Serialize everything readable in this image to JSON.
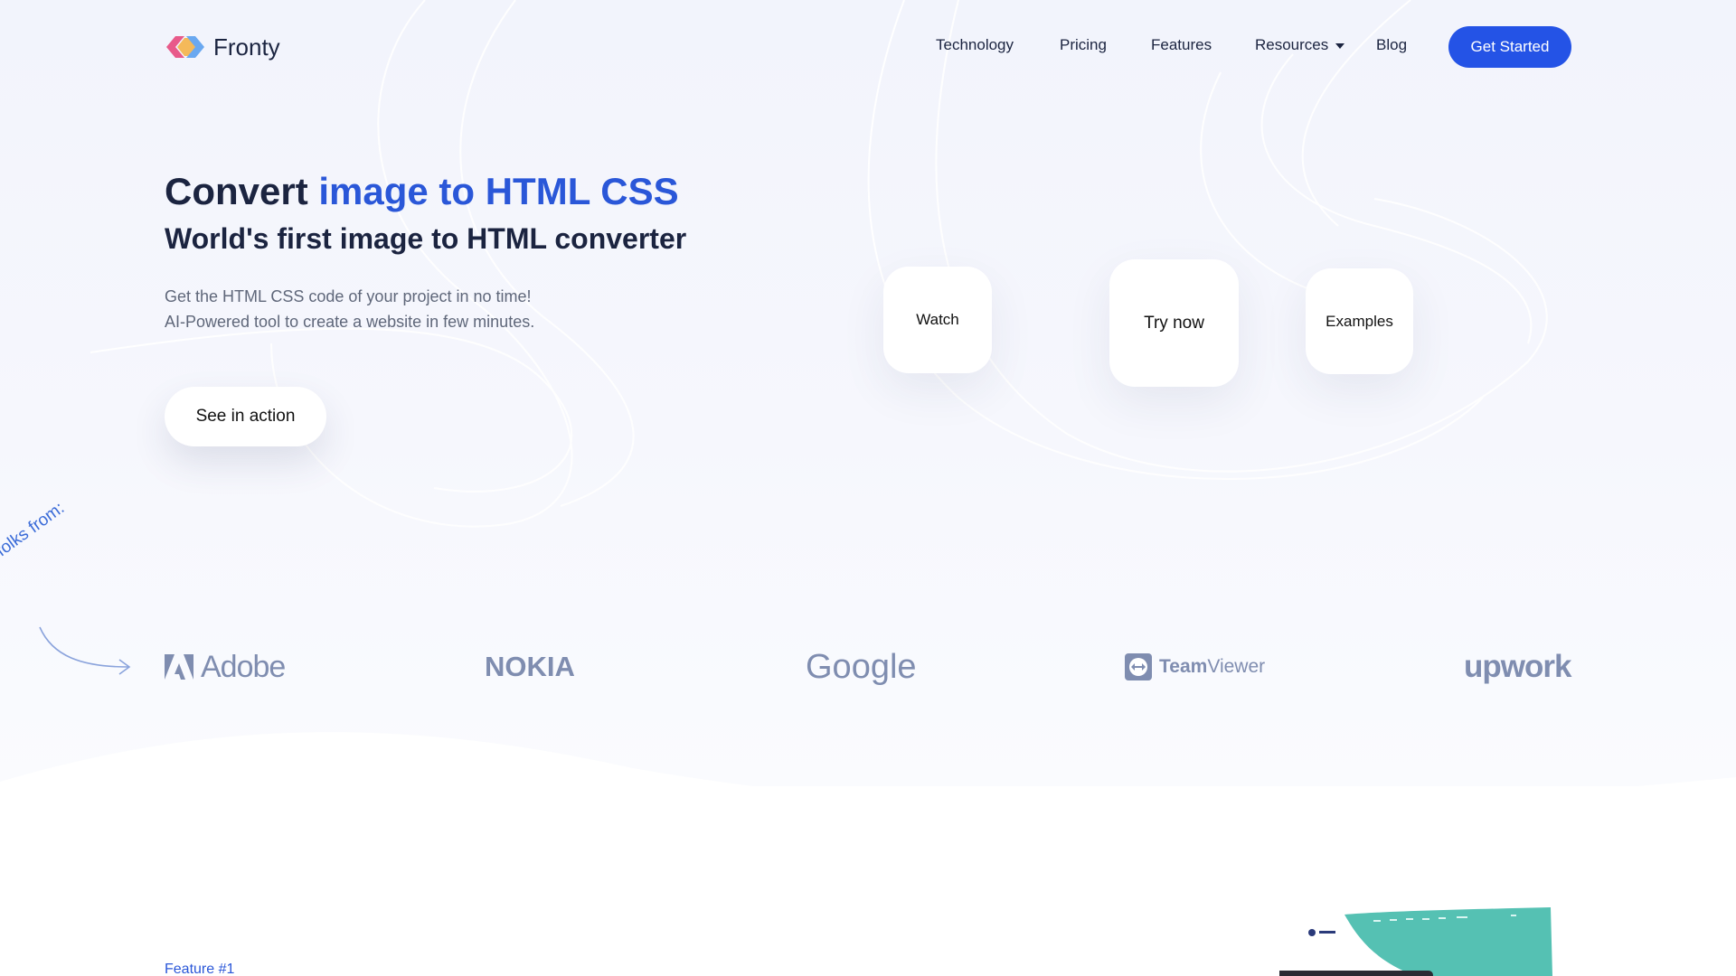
{
  "brand": {
    "name": "Fronty"
  },
  "nav": {
    "items": [
      {
        "label": "Technology"
      },
      {
        "label": "Pricing"
      },
      {
        "label": "Features"
      },
      {
        "label": "Resources"
      },
      {
        "label": "Blog"
      }
    ],
    "cta_label": "Get Started"
  },
  "hero": {
    "title_prefix": "Convert ",
    "title_accent": "image to HTML CSS",
    "subtitle": "World's first image to HTML converter",
    "desc_line1": "Get the HTML CSS code of your project in no time!",
    "desc_line2": "AI-Powered tool to create a website in few minutes.",
    "action_label": "See in action",
    "cards": {
      "watch": "Watch",
      "try": "Try now",
      "examples": "Examples"
    }
  },
  "trusted": {
    "label": "y folks from:",
    "brands": {
      "adobe": "Adobe",
      "nokia": "NOKIA",
      "google": "Google",
      "team_a": "Team",
      "team_b": "Viewer",
      "upwork": "upwork"
    }
  },
  "features": {
    "first_label": "Feature #1"
  },
  "colors": {
    "accent": "#2453e6",
    "title_accent": "#2a57d8",
    "logo_pink": "#e85a8a",
    "logo_yellow": "#f4b95a",
    "logo_blue": "#6aa8f0",
    "brand_gray": "#7f8db0",
    "mock_teal": "#55c1b3"
  }
}
